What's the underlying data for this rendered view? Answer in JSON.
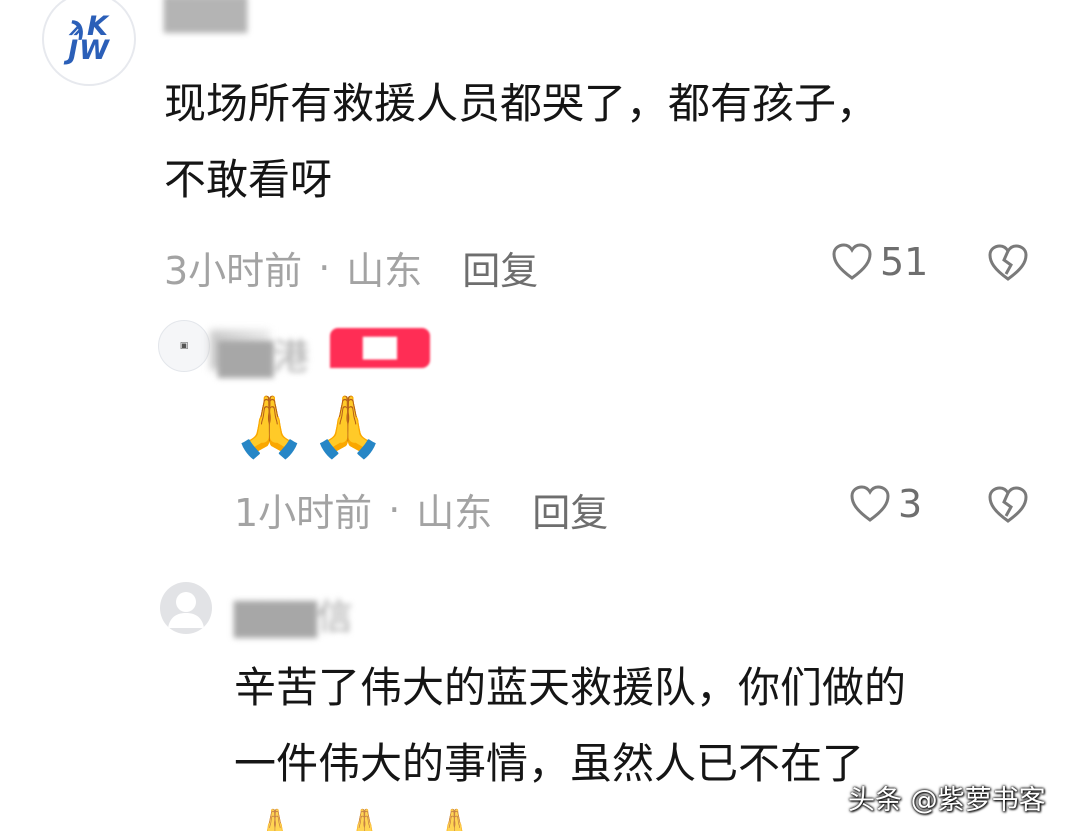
{
  "comments": [
    {
      "username": "",
      "text_lines": [
        "现场所有救援人员都哭了，都有孩子，",
        "不敢看呀"
      ],
      "time": "3小时前",
      "location": "山东",
      "reply_label": "回复",
      "likes": "51"
    },
    {
      "username": "",
      "emoji": [
        "🙏",
        "🙏"
      ],
      "time": "1小时前",
      "location": "山东",
      "reply_label": "回复",
      "likes": "3"
    },
    {
      "username": "",
      "text_lines": [
        "辛苦了伟大的蓝天救援队，你们做的",
        "一件伟大的事情，虽然人已不在了"
      ],
      "emoji": [
        "🙏",
        "🙏",
        "🙏"
      ]
    }
  ],
  "separator": "·",
  "watermark": "头条 @紫萝书客",
  "colors": {
    "text": "#151515",
    "meta": "#a3a3a3",
    "badge": "#ff2d55",
    "avatar_logo": "#2b5fb8"
  },
  "icons": [
    "heart-icon",
    "dislike-broken-heart-icon",
    "default-avatar-icon"
  ]
}
